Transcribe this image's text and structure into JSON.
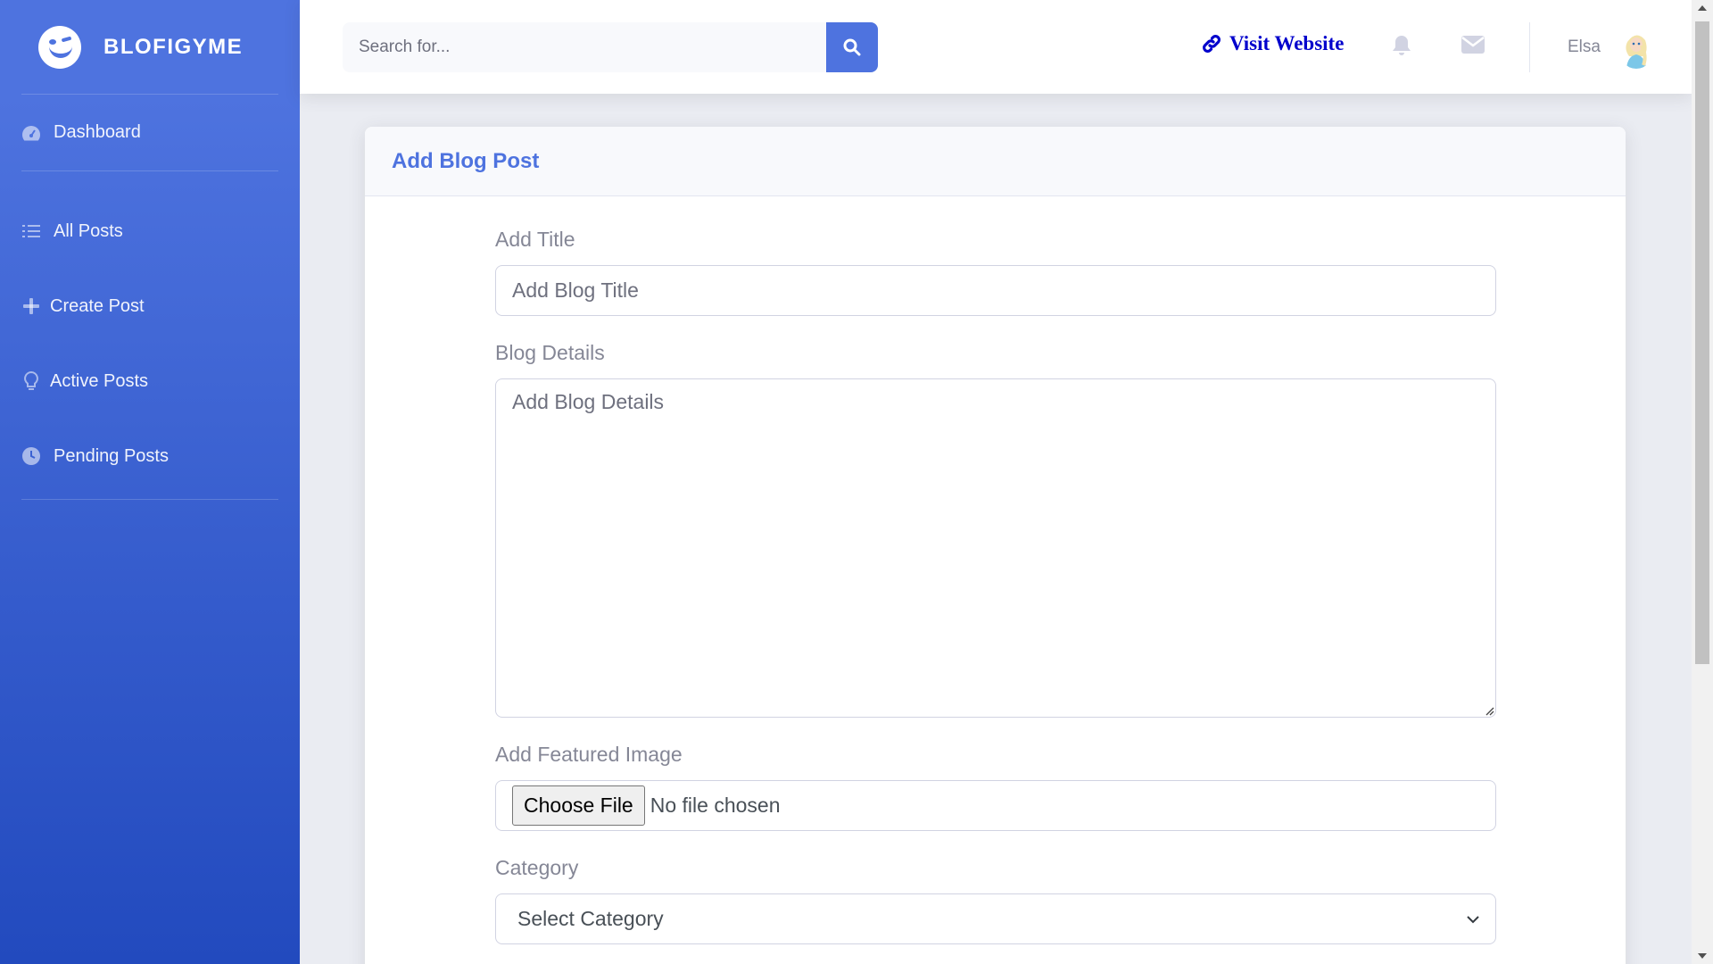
{
  "brand": {
    "name": "BLOFIGYME"
  },
  "sidebar": {
    "items": [
      {
        "label": "Dashboard",
        "icon": "tachometer-icon"
      },
      {
        "label": "All Posts",
        "icon": "list-icon"
      },
      {
        "label": "Create Post",
        "icon": "plus-icon"
      },
      {
        "label": "Active Posts",
        "icon": "lightbulb-icon"
      },
      {
        "label": "Pending Posts",
        "icon": "clock-icon"
      }
    ]
  },
  "topbar": {
    "search_placeholder": "Search for...",
    "visit_label": "Visit Website",
    "user_name": "Elsa"
  },
  "card": {
    "title": "Add Blog Post",
    "title_label": "Add Title",
    "title_placeholder": "Add Blog Title",
    "details_label": "Blog Details",
    "details_placeholder": "Add Blog Details",
    "image_label": "Add Featured Image",
    "file_button": "Choose File",
    "file_status": "No file chosen",
    "category_label": "Category",
    "category_selected": "Select Category"
  },
  "colors": {
    "primary": "#4e73df",
    "sidebar_gradient_end": "#224abe",
    "visit_link": "#0000cc",
    "muted_text": "#858796"
  }
}
